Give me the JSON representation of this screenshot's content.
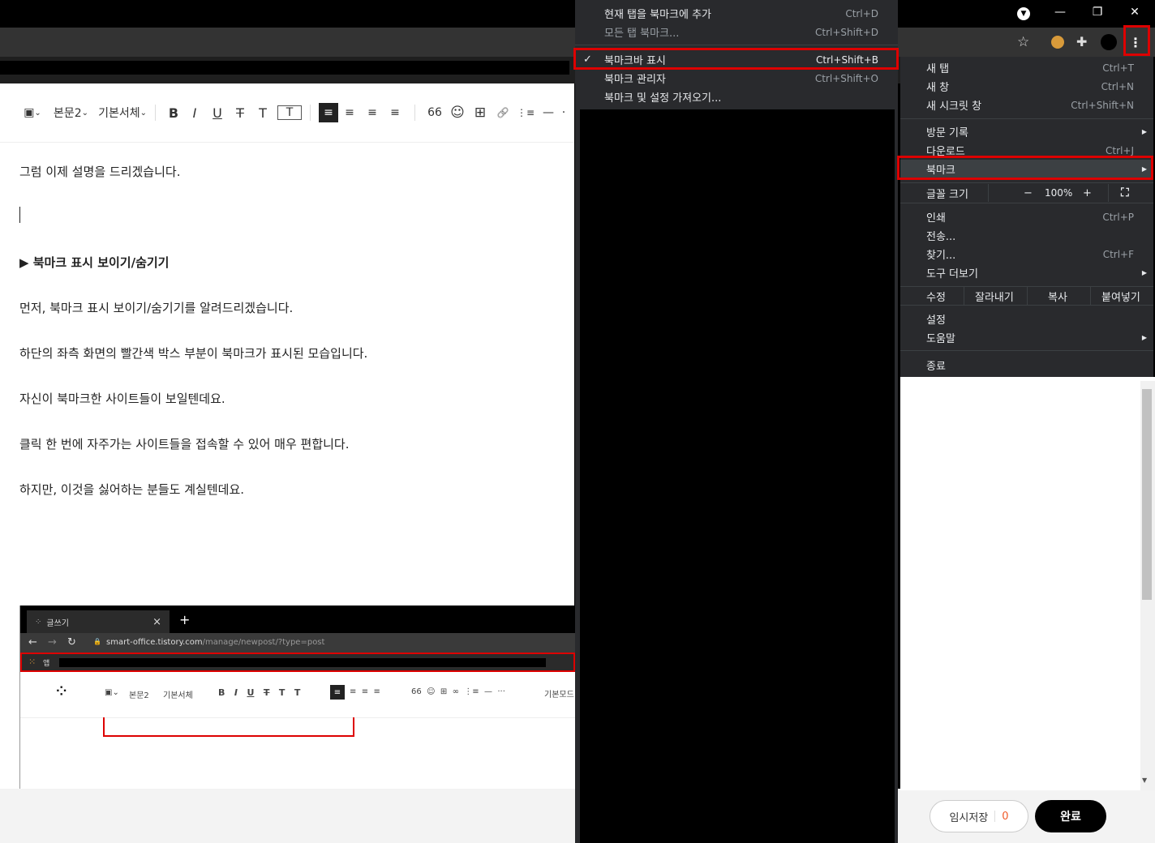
{
  "window": {
    "minimize_glyph": "—",
    "restore_glyph": "❐",
    "close_glyph": "✕"
  },
  "toolbar": {
    "image_glyph": "▣",
    "style_label": "본문2",
    "font_label": "기본서체",
    "caret": "⌄",
    "bold": "B",
    "italic": "I",
    "underline": "U",
    "strike": "T",
    "textcolor": "T",
    "bgcolor": "T",
    "align_glyph": "≡",
    "quote": "66",
    "emoji": "☺",
    "table": "⊞",
    "link": "🔗",
    "list": "⋮≡",
    "hr": "—",
    "more": "·"
  },
  "content": {
    "p1": "그럼 이제 설명을 드리겠습니다.",
    "heading": "▶ 북마크 표시 보이기/숨기기",
    "p2": "먼저, 북마크 표시 보이기/숨기기를 알려드리겠습니다.",
    "p3": "하단의 좌측 화면의 빨간색 박스 부분이 북마크가 표시된 모습입니다.",
    "p4": "자신이 북마크한 사이트들이 보일텐데요.",
    "p5": "클릭 한 번에 자주가는 사이트들을 접속할 수 있어 매우 편합니다.",
    "p6": "하지만, 이것을 싫어하는 분들도 계실텐데요."
  },
  "embedded": {
    "tab_title": "글쓰기",
    "tab_close": "×",
    "new_tab": "+",
    "url_host": "smart-office.tistory.com",
    "url_path": "/manage/newpost/?type=post",
    "apps_label": "앱",
    "style_label": "본문2",
    "font_label": "기본서체",
    "mode_label": "기본모드"
  },
  "bookmark_submenu": {
    "items": [
      {
        "label": "현재 탭을 북마크에 추가",
        "shortcut": "Ctrl+D"
      },
      {
        "label": "모든 탭 북마크...",
        "shortcut": "Ctrl+Shift+D"
      },
      {
        "label": "북마크바 표시",
        "shortcut": "Ctrl+Shift+B",
        "check": "✓"
      },
      {
        "label": "북마크 관리자",
        "shortcut": "Ctrl+Shift+O"
      },
      {
        "label": "북마크 및 설정 가져오기...",
        "shortcut": ""
      }
    ]
  },
  "main_menu": {
    "new_tab": {
      "label": "새 탭",
      "shortcut": "Ctrl+T"
    },
    "new_window": {
      "label": "새 창",
      "shortcut": "Ctrl+N"
    },
    "incognito": {
      "label": "새 시크릿 창",
      "shortcut": "Ctrl+Shift+N"
    },
    "history": {
      "label": "방문 기록"
    },
    "downloads": {
      "label": "다운로드",
      "shortcut": "Ctrl+J"
    },
    "bookmarks": {
      "label": "북마크"
    },
    "zoom": {
      "label": "글꼴 크기",
      "minus": "−",
      "value": "100%",
      "plus": "+"
    },
    "print": {
      "label": "인쇄",
      "shortcut": "Ctrl+P"
    },
    "cast": {
      "label": "전송..."
    },
    "find": {
      "label": "찾기...",
      "shortcut": "Ctrl+F"
    },
    "more_tools": {
      "label": "도구 더보기"
    },
    "edit": {
      "label": "수정",
      "cut": "잘라내기",
      "copy": "복사",
      "paste": "붙여넣기"
    },
    "settings": {
      "label": "설정"
    },
    "help": {
      "label": "도움말"
    },
    "exit": {
      "label": "종료"
    }
  },
  "bottom": {
    "save_label": "임시저장",
    "save_count": "0",
    "done_label": "완료"
  },
  "colors": {
    "highlight_red": "#dd0000",
    "menu_bg": "#292a2d",
    "accent_orange": "#f05a28"
  }
}
